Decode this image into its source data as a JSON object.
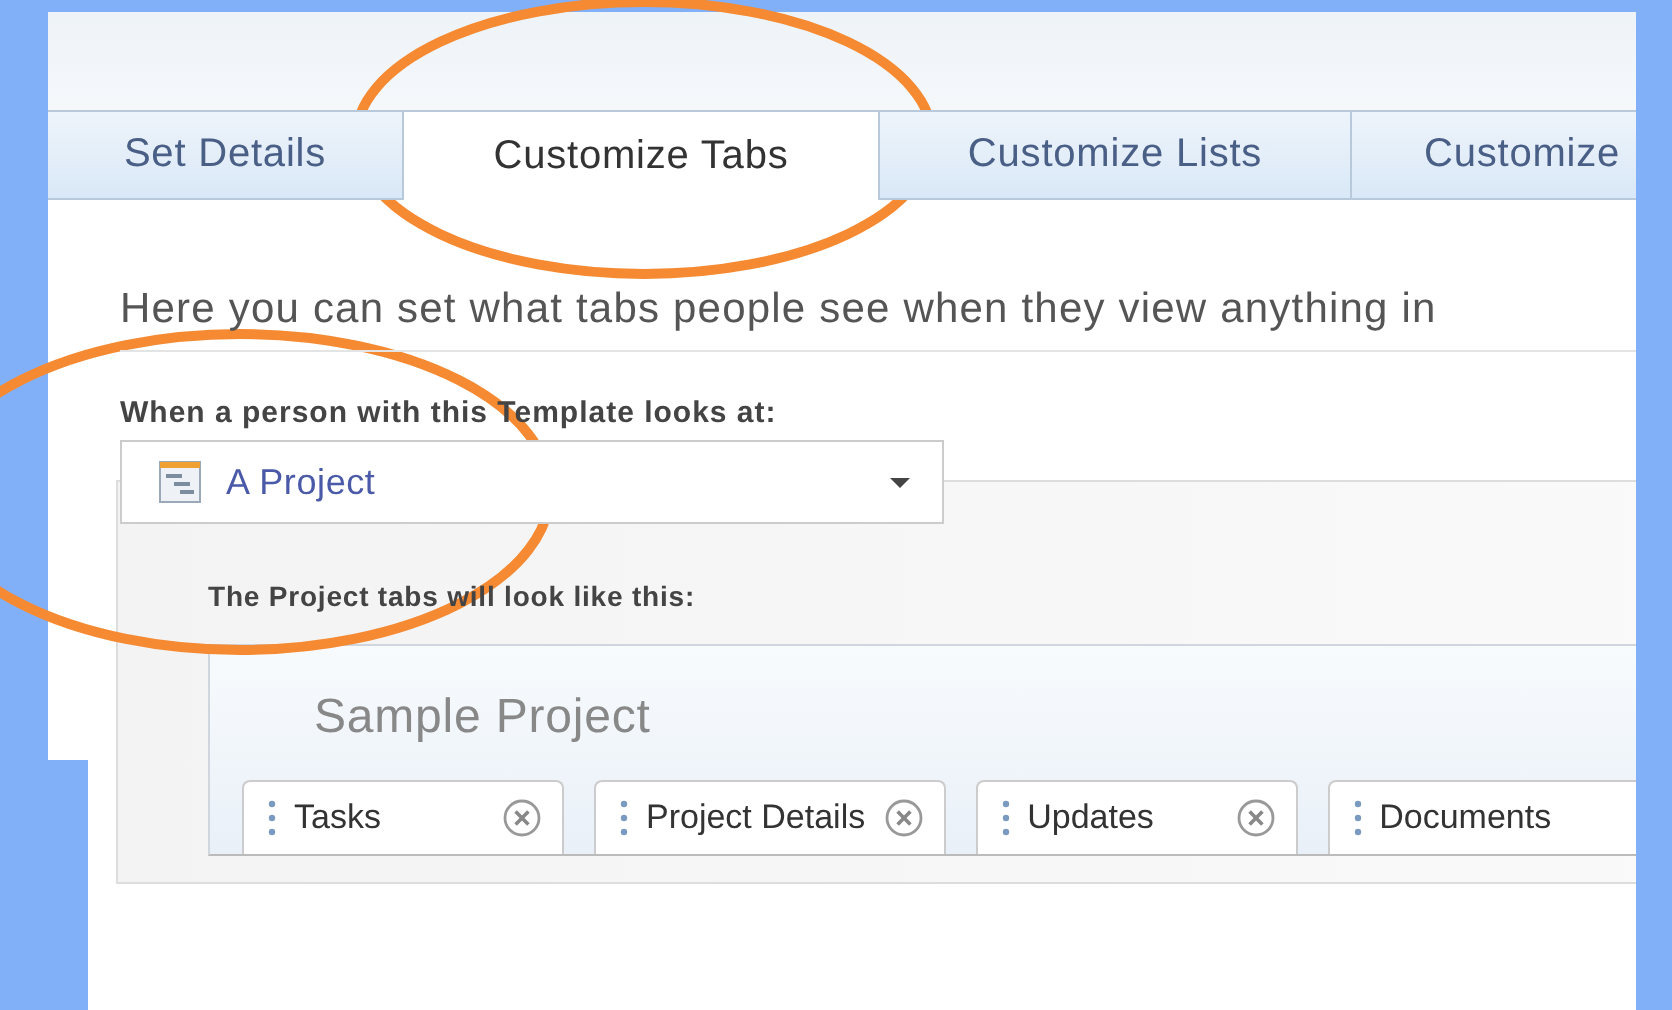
{
  "tabs": [
    {
      "label": "Set Details",
      "selected": false
    },
    {
      "label": "Customize Tabs",
      "selected": true
    },
    {
      "label": "Customize Lists",
      "selected": false
    },
    {
      "label": "Customize",
      "selected": false
    }
  ],
  "description": "Here you can set what tabs people see when they view anything in",
  "object_picker": {
    "label": "When a person with this Template looks at:",
    "value": "A Project"
  },
  "preview": {
    "label": "The Project tabs will look like this:",
    "title": "Sample Project",
    "tabs": [
      {
        "label": "Tasks"
      },
      {
        "label": "Project Details"
      },
      {
        "label": "Updates"
      },
      {
        "label": "Documents"
      }
    ]
  }
}
